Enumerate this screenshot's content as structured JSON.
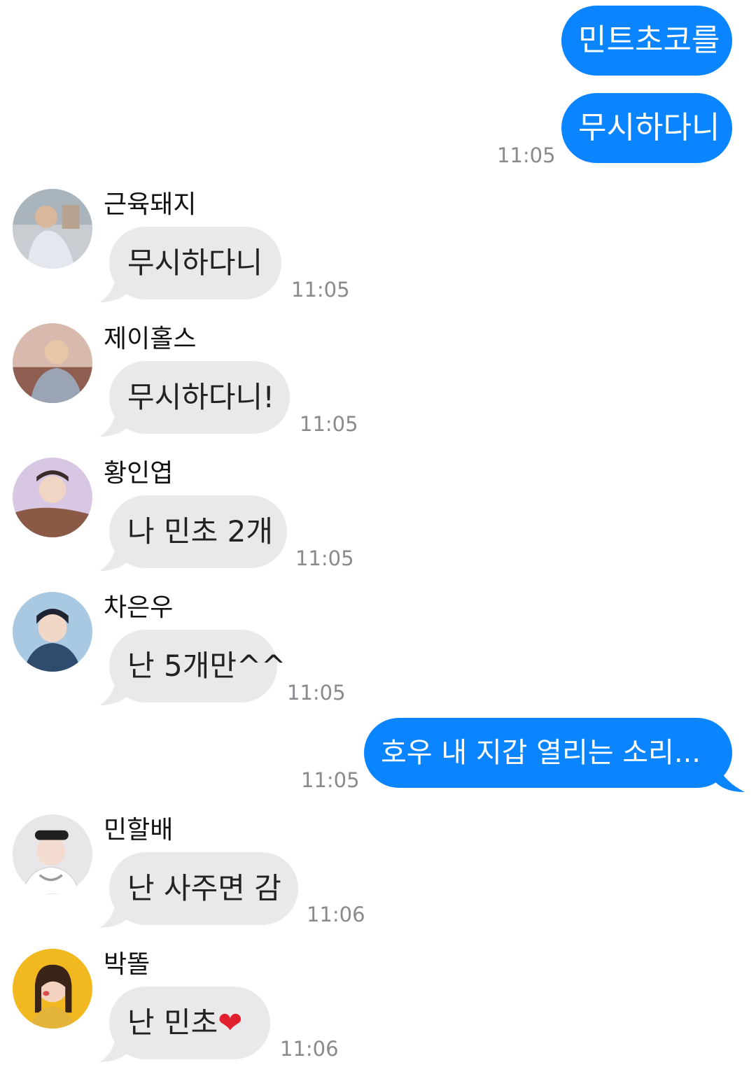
{
  "conversation": {
    "outgoing": [
      {
        "text": "민트초코를"
      },
      {
        "text": "무시하다니",
        "time": "11:05"
      },
      {
        "text": "호우 내 지갑 열리는 소리...",
        "time": "11:05"
      }
    ],
    "incoming": [
      {
        "name": "근육돼지",
        "text": "무시하다니",
        "time": "11:05"
      },
      {
        "name": "제이홀스",
        "text": "무시하다니!",
        "time": "11:05"
      },
      {
        "name": "황인엽",
        "text": "나 민초 2개",
        "time": "11:05"
      },
      {
        "name": "차은우",
        "text": "난 5개만^^",
        "time": "11:05"
      },
      {
        "name": "민할배",
        "text": "난 사주면 감",
        "time": "11:06"
      },
      {
        "name": "박똘",
        "text": "난 민초",
        "emoji": "❤",
        "time": "11:06"
      }
    ]
  },
  "colors": {
    "outgoing_bubble": "#0a84ff",
    "incoming_bubble": "#e9e9eb",
    "timestamp": "#8a8a8e"
  }
}
